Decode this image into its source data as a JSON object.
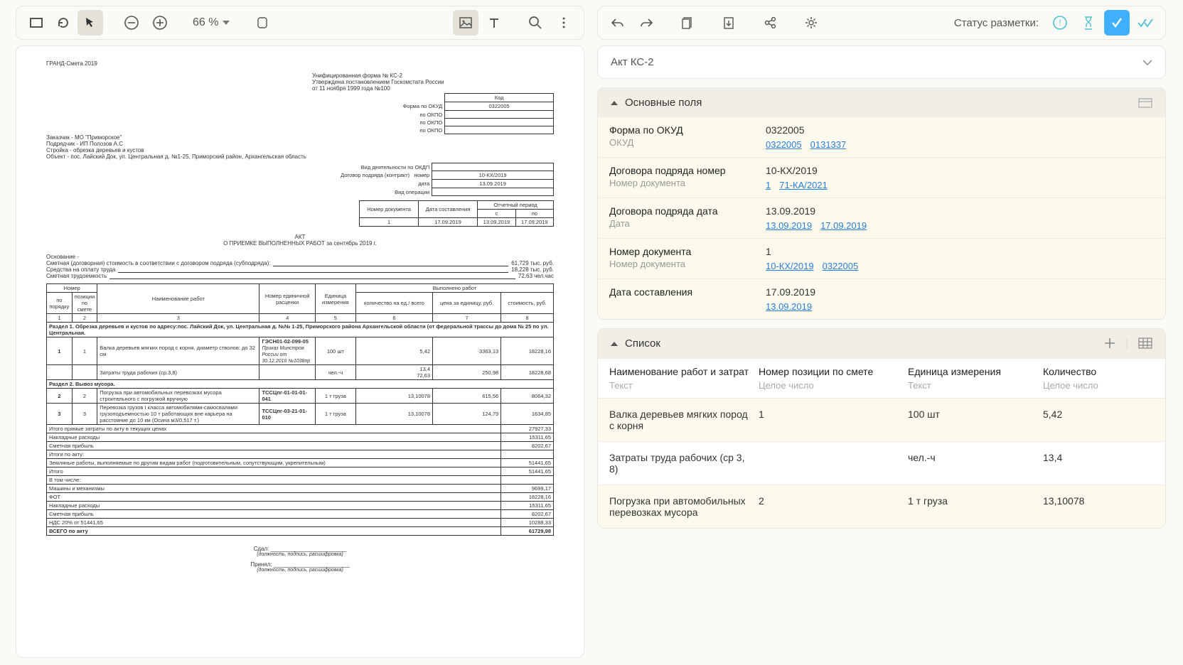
{
  "toolbar": {
    "zoom": "66 %"
  },
  "status_label": "Статус разметки:",
  "panel_title": "Акт КС-2",
  "main_section": {
    "title": "Основные поля",
    "fields": [
      {
        "label": "Форма по ОКУД",
        "sublabel": "ОКУД",
        "value": "0322005",
        "links": [
          "0322005",
          "0131337"
        ]
      },
      {
        "label": "Договора подряда номер",
        "sublabel": "Номер документа",
        "value": "10-КХ/2019",
        "links": [
          "1",
          "71-КА/2021"
        ]
      },
      {
        "label": "Договора подряда дата",
        "sublabel": "Дата",
        "value": "13.09.2019",
        "links": [
          "13.09.2019",
          "17.09.2019"
        ]
      },
      {
        "label": "Номер документа",
        "sublabel": "Номер документа",
        "value": "1",
        "links": [
          "10-КХ/2019",
          "0322005"
        ]
      },
      {
        "label": "Дата составления",
        "sublabel": "",
        "value": "17.09.2019",
        "links": [
          "13.09.2019"
        ]
      }
    ]
  },
  "list_section": {
    "title": "Список",
    "columns": [
      {
        "h": "Наименование работ и затрат",
        "t": "Текст"
      },
      {
        "h": "Номер позиции по смете",
        "t": "Целое число"
      },
      {
        "h": "Единица измерения",
        "t": "Текст"
      },
      {
        "h": "Количество",
        "t": "Целое число"
      }
    ],
    "rows": [
      {
        "c1": "Валка деревьев мягких пород с корня",
        "c2": "1",
        "c3": "100 шт",
        "c4": "5,42"
      },
      {
        "c1": "Затраты труда рабочих (ср 3, 8)",
        "c2": "",
        "c3": "чел.-ч",
        "c4": "13,4"
      },
      {
        "c1": "Погрузка при автомобильных перевозках мусора",
        "c2": "2",
        "c3": "1 т груза",
        "c4": "13,10078"
      }
    ]
  },
  "doc": {
    "software": "ГРАНД-Смета 2019",
    "form_title": "Унифицированная форма № КС-2",
    "approved": "Утверждена постановлением Госкомстата России",
    "approved2": "от 11 ноября 1999 года №100",
    "code_label": "Код",
    "form_okud_label": "Форма по ОКУД",
    "form_okud": "0322005",
    "by_okpo": "по ОКПО",
    "customer": "МО \"Приморское\"",
    "contractor": "ИП Полозов А.С",
    "construction": "обрезка деревьев и кустов",
    "object": "пос. Лайский Док, ул. Центральная д. №1-25, Приморский район, Архангельская область",
    "by_okdp": "Вид деятельности по ОКДП",
    "contract_label": "Договор подряда (контракт)",
    "contract_num_lbl": "номер",
    "contract_num": "10-КХ/2019",
    "contract_date_lbl": "дата",
    "contract_date": "13.09.2019",
    "operation_lbl": "Вид операции",
    "hdr": {
      "num": "Номер документа",
      "date": "Дата составления",
      "period": "Отчетный период",
      "from": "с",
      "to": "по"
    },
    "hdr_vals": {
      "num": "1",
      "date": "17.09.2019",
      "from": "13.09.2019",
      "to": "17.09.2019"
    },
    "act_title": "АКТ",
    "act_sub": "О ПРИЕМКЕ ВЫПОЛНЕННЫХ РАБОТ за сентябрь 2019 г.",
    "basis": "Основание -",
    "est": "Сметная (договорная) стоимость в соответствии с договором подряда (субподряда):",
    "est_v": "61,729 тыс. руб.",
    "labor": "Средства на оплату труда",
    "labor_v": "18,228 тыс. руб.",
    "effort": "Сметная трудоемкость",
    "effort_v": "72,63 чел.час",
    "th": {
      "n": "Номер",
      "npp": "по порядку",
      "nps": "позиции по смете",
      "name": "Наименование работ",
      "unit_code": "Номер единичной расценки",
      "unit": "Единица измерения",
      "done": "Выполнено работ",
      "qty": "количество на ед./ всего",
      "price": "цена за единицу, руб.",
      "cost": "стоимость, руб."
    },
    "thnums": [
      "1",
      "2",
      "3",
      "4",
      "5",
      "6",
      "7",
      "8"
    ],
    "sec1": "Раздел 1. Обрезка деревьев и кустов по адресу:пос. Лайский Док, ул. Центральная д. №№ 1-25, Приморского района Архангельской области (от федеральной трассы до дома № 25 по ул. Центральная.",
    "r1": {
      "n": "1",
      "p": "1",
      "name": "Валка деревьев мягких пород с корня, диаметр стволов: до 32 см",
      "code": "ГЭСН01-02-099-05",
      "code2": "Приказ Минстроя России от 30.12.2016 №1038пр",
      "unit": "100 шт",
      "qty": "5,42",
      "price": "3363,13",
      "cost": "18228,16"
    },
    "r1a": {
      "name": "Затраты труда рабочих (ср.3,8)",
      "unit": "чел.-ч",
      "qty": "13,4",
      "qty2": "72,63",
      "price": "250,98",
      "cost": "18228,68"
    },
    "sec2": "Раздел 2. Вывоз мусора.",
    "r2": {
      "n": "2",
      "p": "2",
      "name": "Погрузка при автомобильных перевозках мусора строительного с погрузкой вручную",
      "code": "ТССЦпг-01-01-01-041",
      "unit": "1 т груза",
      "qty": "13,10078",
      "price": "615,56",
      "cost": "8064,32"
    },
    "r3": {
      "n": "3",
      "p": "3",
      "name": "Перевозка грузов I класса автомобилями-самосвалами грузоподъемностью 10 т работающих вне карьера на расстояние до 10 км (Осина м3/0,517 т.)",
      "code": "ТССЦпг-03-21-01-010",
      "unit": "1 т груза",
      "qty": "13,10078",
      "price": "124,79",
      "cost": "1634,85"
    },
    "totals": [
      {
        "l": "Итого прямые затраты по акту в текущих ценах",
        "v": "27927,33"
      },
      {
        "l": "Накладные расходы",
        "v": "15311,65"
      },
      {
        "l": "Сметная прибыль",
        "v": "8202,67"
      },
      {
        "l": "Итоги по акту:",
        "v": ""
      },
      {
        "l": "   Земляные работы, выполняемые по другим видам работ (подготовительным, сопутствующим, укрепительным)",
        "v": "51441,65"
      },
      {
        "l": "Итого",
        "v": "51441,65"
      },
      {
        "l": "В том числе:",
        "v": ""
      },
      {
        "l": "   Машины и механизмы",
        "v": "9699,17"
      },
      {
        "l": "   ФОТ",
        "v": "18228,16"
      },
      {
        "l": "   Накладные расходы",
        "v": "15311,65"
      },
      {
        "l": "   Сметная прибыль",
        "v": "8202,67"
      },
      {
        "l": "НДС 20% от 51441,65",
        "v": "10288,33"
      },
      {
        "l": "ВСЕГО по акту",
        "v": "61729,98",
        "b": true
      }
    ],
    "sign1": "Сдал:",
    "sign1s": "(должность, подпись, расшифровка)",
    "sign2": "Принял:",
    "sign2s": "(должность, подпись, расшифровка)"
  }
}
